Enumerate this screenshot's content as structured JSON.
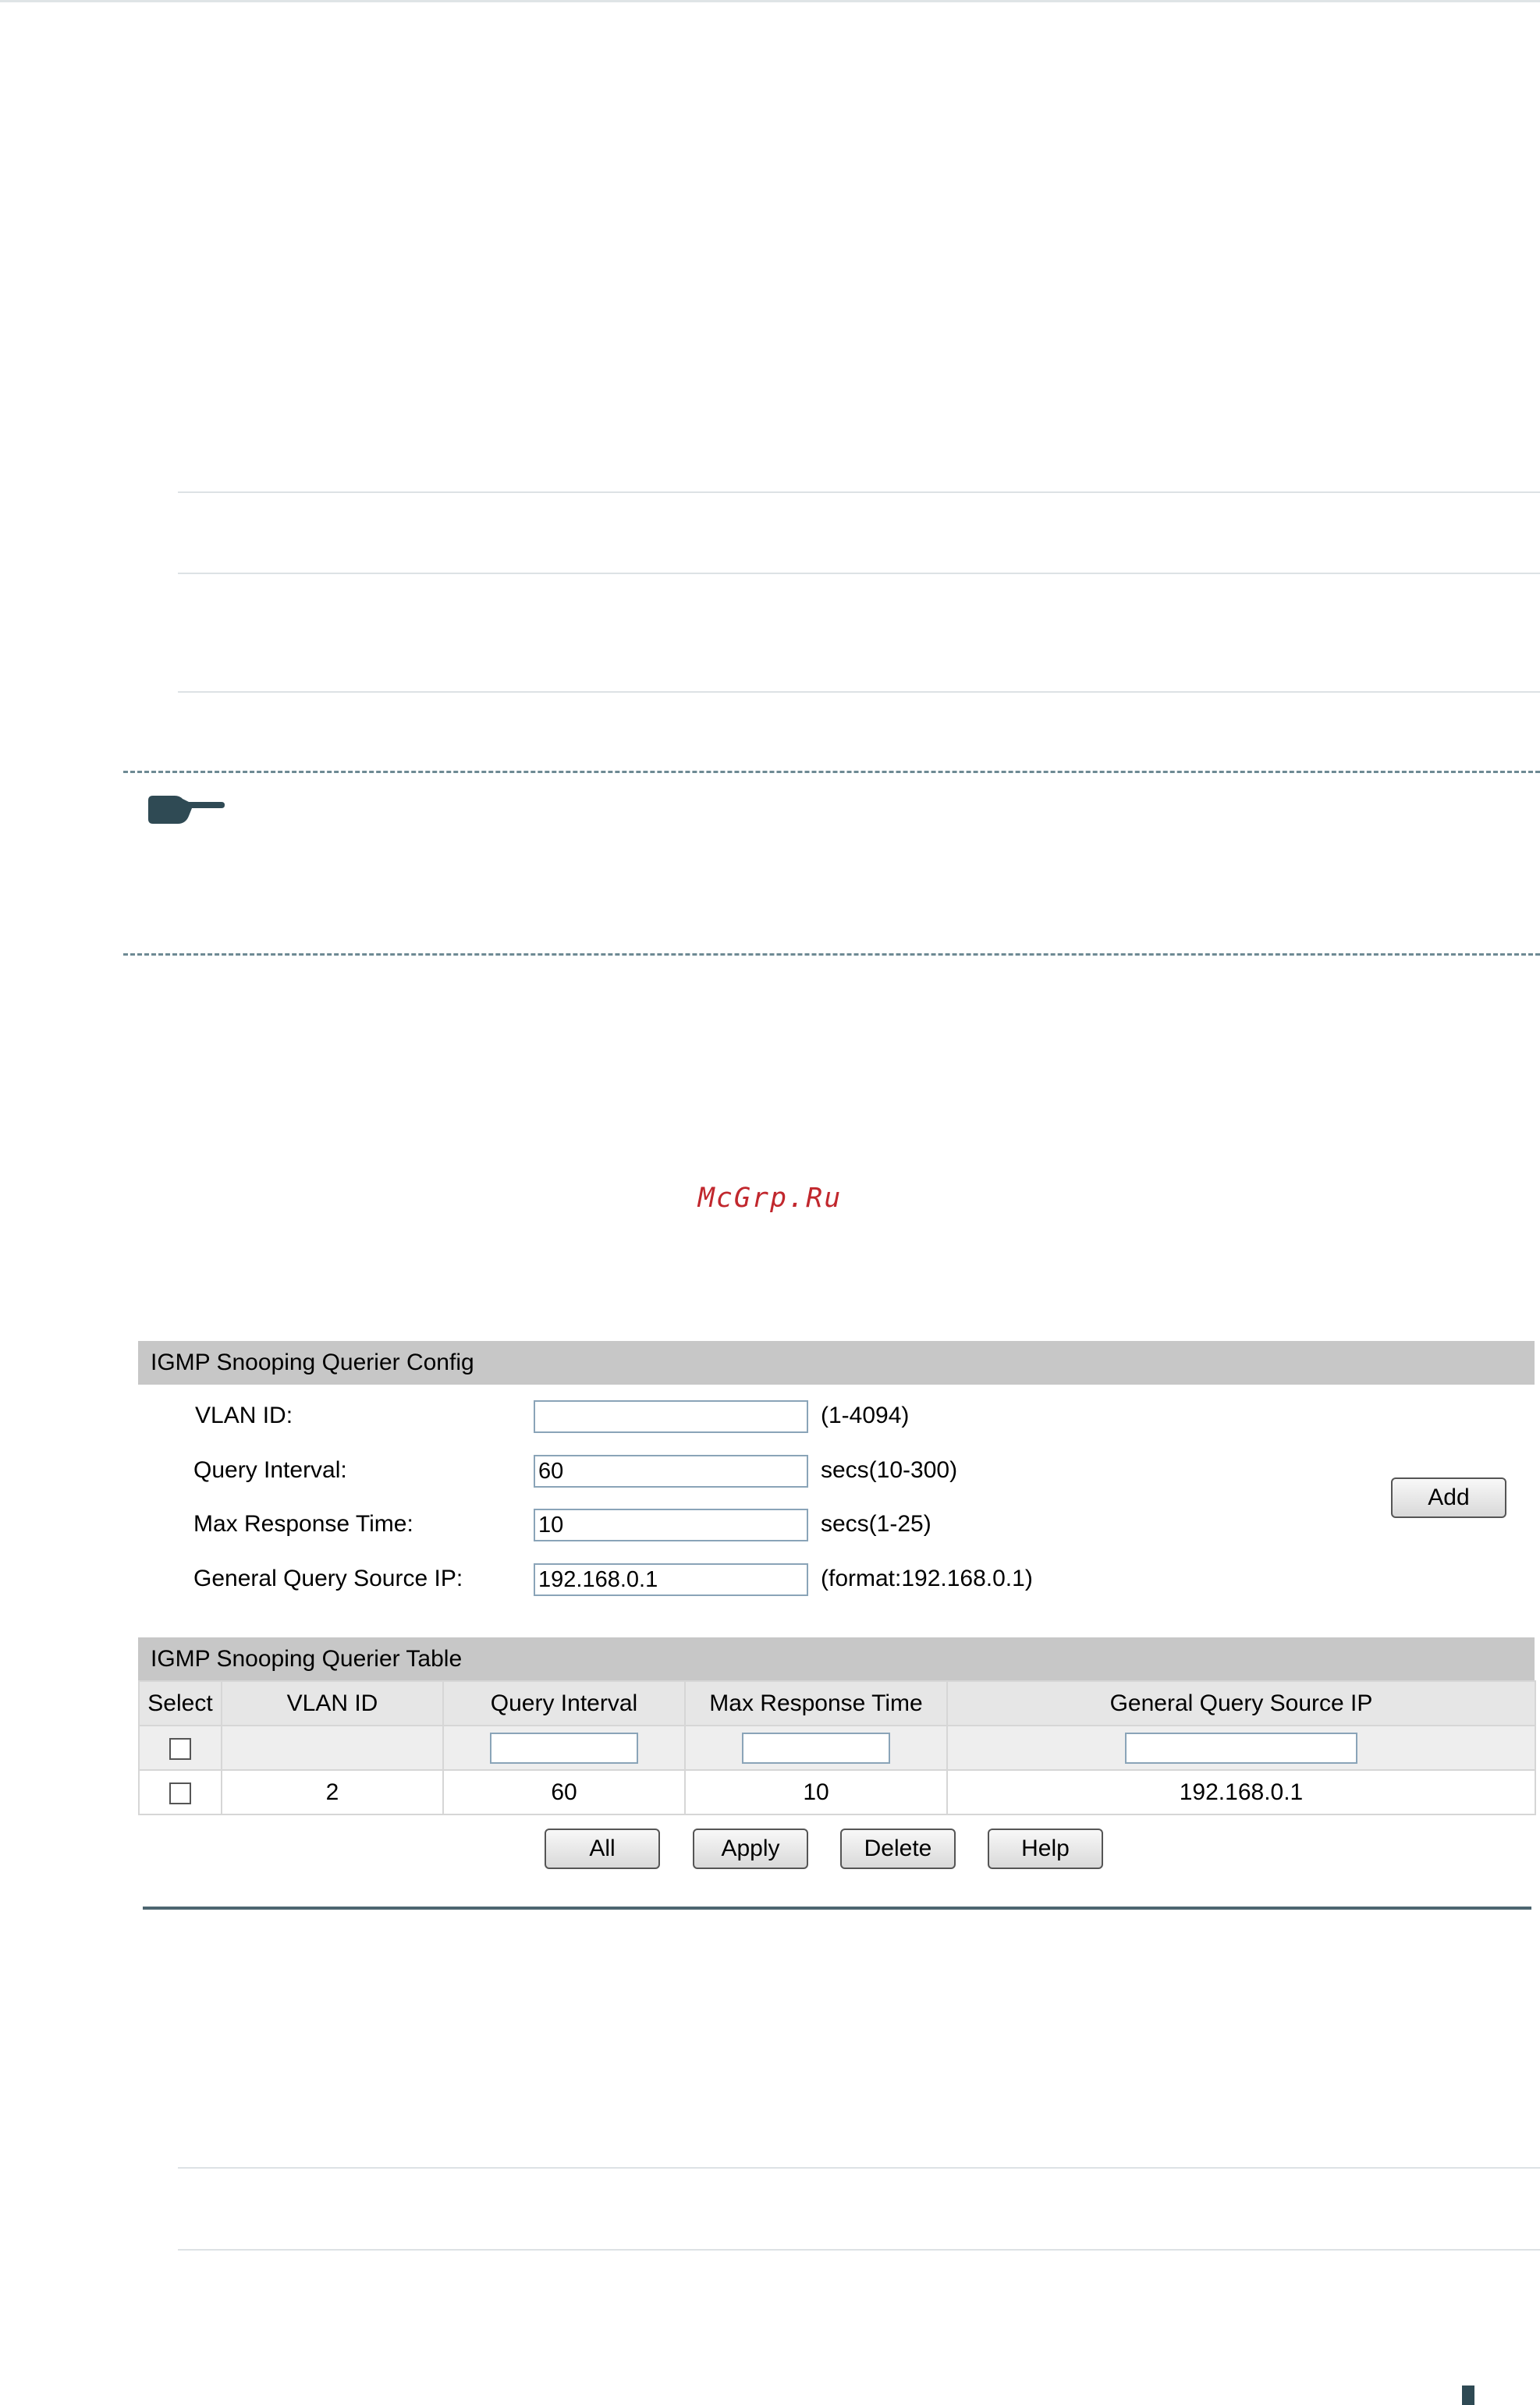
{
  "watermark": "McGrp.Ru",
  "config": {
    "header": "IGMP Snooping Querier Config",
    "fields": [
      {
        "label": "VLAN ID:",
        "value": "",
        "hint": "(1-4094)"
      },
      {
        "label": "Query Interval:",
        "value": "60",
        "hint": "secs(10-300)"
      },
      {
        "label": "Max Response Time:",
        "value": "10",
        "hint": "secs(1-25)"
      },
      {
        "label": "General Query Source IP:",
        "value": "192.168.0.1",
        "hint": "(format:192.168.0.1)"
      }
    ],
    "add_label": "Add"
  },
  "table": {
    "header": "IGMP Snooping Querier Table",
    "columns": [
      "Select",
      "VLAN ID",
      "Query Interval",
      "Max Response Time",
      "General Query Source IP"
    ],
    "rows": [
      {
        "vlan_id": "2",
        "query_interval": "60",
        "max_response_time": "10",
        "source_ip": "192.168.0.1"
      }
    ]
  },
  "buttons": {
    "all": "All",
    "apply": "Apply",
    "delete": "Delete",
    "help": "Help"
  },
  "colors": {
    "panel_header": "#c7c7c7",
    "watermark": "#c1272d",
    "rule": "#4d6670"
  }
}
